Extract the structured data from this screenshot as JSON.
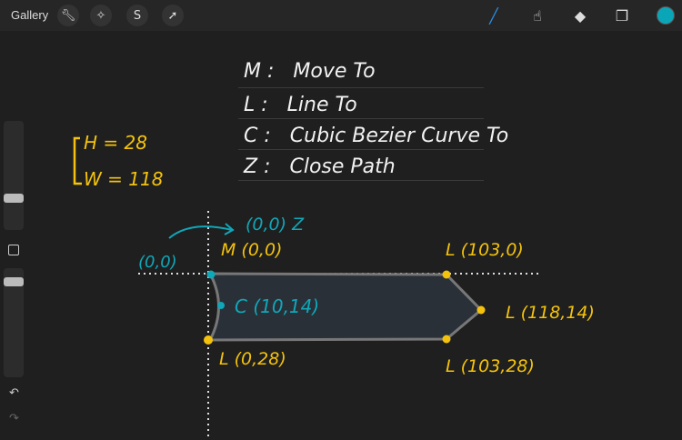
{
  "toolbar": {
    "gallery_label": "Gallery",
    "left_tools": [
      "wrench-icon",
      "magic-wand-icon",
      "selection-icon",
      "transform-arrow-icon"
    ],
    "right_tools": [
      "brush-icon",
      "smudge-icon",
      "eraser-icon",
      "layers-icon"
    ],
    "current_color": "#0aa6b8"
  },
  "notes": {
    "legend": [
      {
        "key": "M",
        "desc": "Move To"
      },
      {
        "key": "L",
        "desc": "Line To"
      },
      {
        "key": "C",
        "desc": "Cubic Bezier Curve To"
      },
      {
        "key": "Z",
        "desc": "Close Path"
      }
    ],
    "height_label": "H = 28",
    "width_label": "W = 118"
  },
  "diagram": {
    "origin_label": "(0,0)",
    "close_label": "(0,0) Z",
    "points": {
      "m": "M (0,0)",
      "l1": "L (103,0)",
      "l2": "L (118,14)",
      "l3": "L (103,28)",
      "l4": "L (0,28)",
      "c": "C (10,14)"
    }
  },
  "colors": {
    "yellow": "#f4c20d",
    "cyan": "#10a7b8",
    "shape_fill": "#2a3038",
    "shape_stroke": "#777777"
  }
}
